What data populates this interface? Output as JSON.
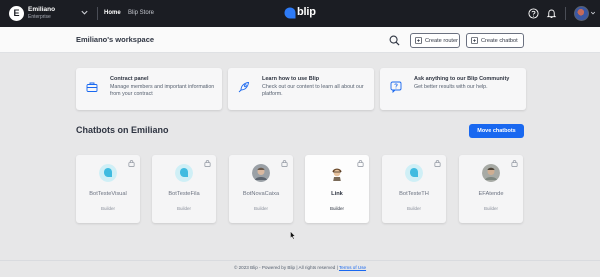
{
  "topbar": {
    "org_initial": "E",
    "org_name": "Emiliano",
    "org_plan": "Enterprise",
    "nav": [
      "Home",
      "Blip Store"
    ],
    "logo_text": "blip",
    "icons": [
      "chevron-down-icon",
      "help-icon",
      "bell-icon",
      "user-avatar",
      "chevron-down-icon"
    ]
  },
  "workspace": {
    "title": "Emiliano's workspace",
    "create_router": "Create router",
    "create_chatbot": "Create chatbot"
  },
  "info_cards": [
    {
      "icon": "briefcase-icon",
      "title": "Contract panel",
      "desc": "Manage members and important information from your contract"
    },
    {
      "icon": "rocket-icon",
      "title": "Learn how to use Blip",
      "desc": "Check out our content to learn all about our platform."
    },
    {
      "icon": "question-icon",
      "title": "Ask anything to our Blip Community",
      "desc": "Get better results with our help."
    }
  ],
  "chatbots": {
    "title": "Chatbots on Emiliano",
    "move_label": "Move chatbots",
    "items": [
      {
        "name": "BotTesteVisual",
        "role": "Builder",
        "avatar": "blip-shield"
      },
      {
        "name": "BotTesteFila",
        "role": "Builder",
        "avatar": "blip-shield"
      },
      {
        "name": "BotNovaCaixa",
        "role": "Builder",
        "avatar": "photo"
      },
      {
        "name": "Link",
        "role": "Builder",
        "avatar": "character"
      },
      {
        "name": "BotTesteTH",
        "role": "Builder",
        "avatar": "blip-shield"
      },
      {
        "name": "EFAtende",
        "role": "Builder",
        "avatar": "photo"
      }
    ]
  },
  "footer": {
    "text": "© 2023 Blip - Powered by Blip | All rights reserved |",
    "link": "Terms of Use"
  },
  "colors": {
    "primary": "#1968f0",
    "topbar": "#1b1d23",
    "background": "#e7e7e8"
  }
}
